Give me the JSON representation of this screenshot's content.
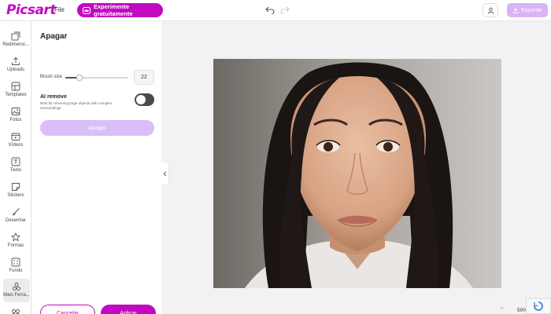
{
  "app": {
    "logo": "Picsart",
    "brand_color": "#c209c1"
  },
  "topbar": {
    "file_label": "File",
    "trial_label": "Experimente gratuitamente",
    "export_label": "Exportar",
    "icons": [
      "crown-icon",
      "undo-icon",
      "redo-icon",
      "user-icon",
      "download-icon"
    ]
  },
  "sidebar": {
    "items": [
      {
        "label": "Redimensi...",
        "icon": "resize-icon"
      },
      {
        "label": "Uploads",
        "icon": "upload-icon"
      },
      {
        "label": "Templates",
        "icon": "templates-icon"
      },
      {
        "label": "Fotos",
        "icon": "photo-icon"
      },
      {
        "label": "Vídeos",
        "icon": "video-icon"
      },
      {
        "label": "Texto",
        "icon": "text-icon"
      },
      {
        "label": "Stickers",
        "icon": "sticker-icon"
      },
      {
        "label": "Desenhar",
        "icon": "brush-icon"
      },
      {
        "label": "Formas",
        "icon": "star-icon"
      },
      {
        "label": "Fundo",
        "icon": "background-icon"
      },
      {
        "label": "Mais Ferra...",
        "icon": "more-tools-icon",
        "active": true
      }
    ]
  },
  "panel": {
    "title": "Apagar",
    "brush_label": "Brush size",
    "brush_value": "22",
    "brush_fraction": 0.22,
    "ai_title": "AI remove",
    "ai_description": "Best for removing large objects with complex surroundings",
    "ai_toggle_on": false,
    "erase_button": "Apagar",
    "cancel_button": "Cancelar",
    "apply_button": "Aplicar"
  },
  "zoom": {
    "value": "50%",
    "minus": "−",
    "plus": "+"
  }
}
